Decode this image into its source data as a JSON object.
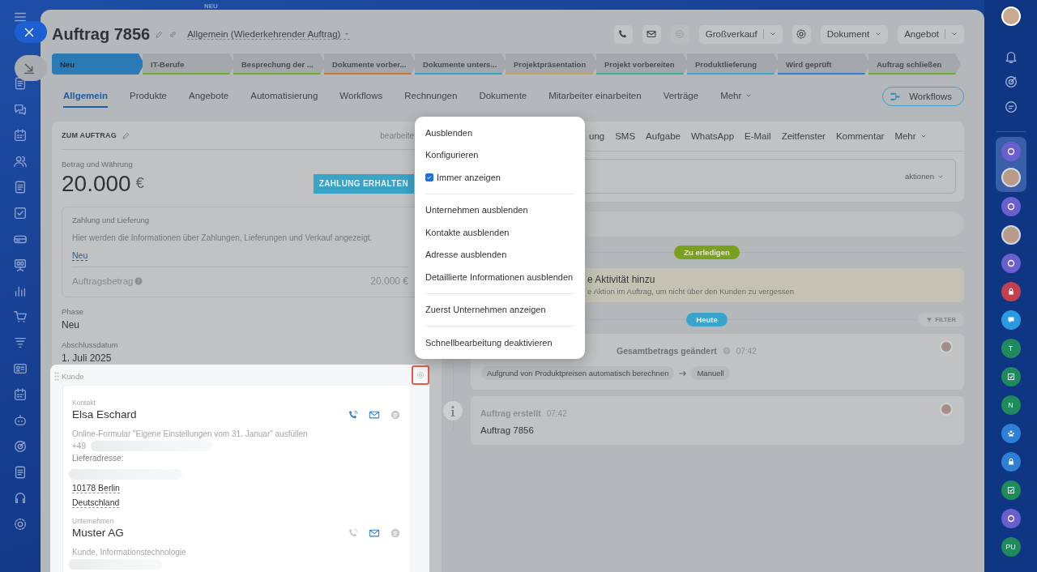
{
  "background_label": "NEU",
  "header": {
    "title": "Auftrag 7856",
    "category": "Allgemein (Wiederkehrender Auftrag)",
    "actions": [
      {
        "kind": "split",
        "label": "Großverkauf"
      },
      {
        "kind": "dropdown",
        "label": "Dokument"
      },
      {
        "kind": "split",
        "label": "Angebot"
      }
    ]
  },
  "stages": [
    {
      "label": "Neu",
      "selected": true,
      "color": "#2b7ab5"
    },
    {
      "label": "IT-Berufe",
      "selected": false,
      "color": "#6fae2c"
    },
    {
      "label": "Besprechung der ...",
      "selected": false,
      "color": "#6fae2c"
    },
    {
      "label": "Dokumente vorber...",
      "selected": false,
      "color": "#c9782e"
    },
    {
      "label": "Dokumente unters...",
      "selected": false,
      "color": "#2fa5cc"
    },
    {
      "label": "Projektpräsentation",
      "selected": false,
      "color": "#c9a060"
    },
    {
      "label": "Projekt vorbereiten",
      "selected": false,
      "color": "#35b394"
    },
    {
      "label": "Produktlieferung",
      "selected": false,
      "color": "#3aa8cf"
    },
    {
      "label": "Wird geprüft",
      "selected": false,
      "color": "#2f7fd0"
    },
    {
      "label": "Auftrag schließen",
      "selected": false,
      "color": "#6fae2c"
    }
  ],
  "tabs": [
    {
      "label": "Allgemein",
      "selected": true,
      "kind": "plain"
    },
    {
      "label": "Produkte",
      "selected": false,
      "kind": "plain"
    },
    {
      "label": "Angebote",
      "selected": false,
      "kind": "plain"
    },
    {
      "label": "Automatisierung",
      "selected": false,
      "kind": "plain"
    },
    {
      "label": "Workflows",
      "selected": false,
      "kind": "plain"
    },
    {
      "label": "Rechnungen",
      "selected": false,
      "kind": "plain"
    },
    {
      "label": "Dokumente",
      "selected": false,
      "kind": "plain"
    },
    {
      "label": "Mitarbeiter einarbeiten",
      "selected": false,
      "kind": "plain"
    },
    {
      "label": "Verträge",
      "selected": false,
      "kind": "plain"
    },
    {
      "label": "Mehr",
      "selected": false,
      "kind": "more"
    }
  ],
  "workflows_button": "Workflows",
  "details_card": {
    "title": "ZUM AUFTRAG",
    "edit_link": "bearbeite",
    "amount_label": "Betrag und Währung",
    "amount": "20.000",
    "currency": "€",
    "pay_button": "ZAHLUNG ERHALTEN",
    "payment": {
      "title": "Zahlung und Lieferung",
      "description": "Hier werden die Informationen über Zahlungen, Lieferungen und Verkauf angezeigt.",
      "link": "Neu",
      "total_label": "Auftragsbetrag",
      "total_value": "20.000 €"
    },
    "fields": [
      {
        "label": "Phase",
        "value": "Neu"
      },
      {
        "label": "Abschlussdatum",
        "value": "1. Juli 2025"
      }
    ]
  },
  "customer_block": {
    "title": "Kunde",
    "contact": {
      "label": "Kontakt",
      "name": "Elsa Eschard",
      "source": "Online-Formular \"Eigene Einstellungen vom 31. Januar\" ausfüllen",
      "phone": "+49",
      "address_label": "Lieferadresse:",
      "address_lines": [
        "10178 Berlin",
        "Deutschland"
      ]
    },
    "company": {
      "label": "Unternehmen",
      "name": "Muster AG",
      "description": "Kunde, Informationstechnologie"
    }
  },
  "context_menu": [
    {
      "kind": "item",
      "label": "Ausblenden"
    },
    {
      "kind": "item",
      "label": "Konfigurieren"
    },
    {
      "kind": "checkbox",
      "label": "Immer anzeigen",
      "checked": true
    },
    {
      "kind": "separator"
    },
    {
      "kind": "item",
      "label": "Unternehmen ausblenden"
    },
    {
      "kind": "item",
      "label": "Kontakte ausblenden"
    },
    {
      "kind": "item",
      "label": "Adresse ausblenden"
    },
    {
      "kind": "item",
      "label": "Detaillierte Informationen ausblenden"
    },
    {
      "kind": "separator"
    },
    {
      "kind": "item",
      "label": "Zuerst Unternehmen anzeigen"
    },
    {
      "kind": "separator"
    },
    {
      "kind": "item",
      "label": "Schnellbearbeitung deaktivieren"
    }
  ],
  "timeline": {
    "tabs": [
      {
        "label": "ung",
        "kind": "plain"
      },
      {
        "label": "SMS",
        "kind": "plain"
      },
      {
        "label": "Aufgabe",
        "kind": "plain"
      },
      {
        "label": "WhatsApp",
        "kind": "plain"
      },
      {
        "label": "E-Mail",
        "kind": "plain"
      },
      {
        "label": "Zeitfenster",
        "kind": "plain"
      },
      {
        "label": "Kommentar",
        "kind": "plain"
      },
      {
        "label": "Mehr",
        "kind": "more"
      }
    ],
    "actions_dropdown": "aktionen",
    "todo_badge": "Zu erledigen",
    "hint": {
      "title": "e Aktivität hinzu",
      "text": "e Aktion im Auftrag, um nicht über den Kunden zu vergessen"
    },
    "today_badge": "Heute",
    "filter_button": "FILTER",
    "events": [
      {
        "kind": "change",
        "title": "Gesamtbetrags geändert",
        "time": "07:42",
        "from": "Aufgrund von Produktpreisen automatisch berechnen",
        "to": "Manuell"
      },
      {
        "kind": "created",
        "title": "Auftrag erstellt",
        "time": "07:42",
        "body": "Auftrag 7856"
      }
    ]
  },
  "right_bar": [
    {
      "kind": "ring",
      "color": "#6b5fd0"
    },
    {
      "kind": "avatar"
    },
    {
      "kind": "ring",
      "color": "#6b5fd0"
    },
    {
      "kind": "avatar"
    },
    {
      "kind": "ring",
      "color": "#6b5fd0"
    },
    {
      "kind": "lock",
      "color": "#c2404f"
    },
    {
      "kind": "chat",
      "color": "#2a9be0"
    },
    {
      "kind": "initials",
      "color": "#1f8a5c",
      "label": "T"
    },
    {
      "kind": "check",
      "color": "#1f8a5c"
    },
    {
      "kind": "initials",
      "color": "#1f8a5c",
      "label": "N"
    },
    {
      "kind": "people",
      "color": "#2e7fd6"
    },
    {
      "kind": "lock",
      "color": "#2e7fd6"
    },
    {
      "kind": "check",
      "color": "#1f8a5c"
    },
    {
      "kind": "ring",
      "color": "#6b5fd0"
    },
    {
      "kind": "initials",
      "color": "#1f8a5c",
      "label": "PU"
    }
  ]
}
